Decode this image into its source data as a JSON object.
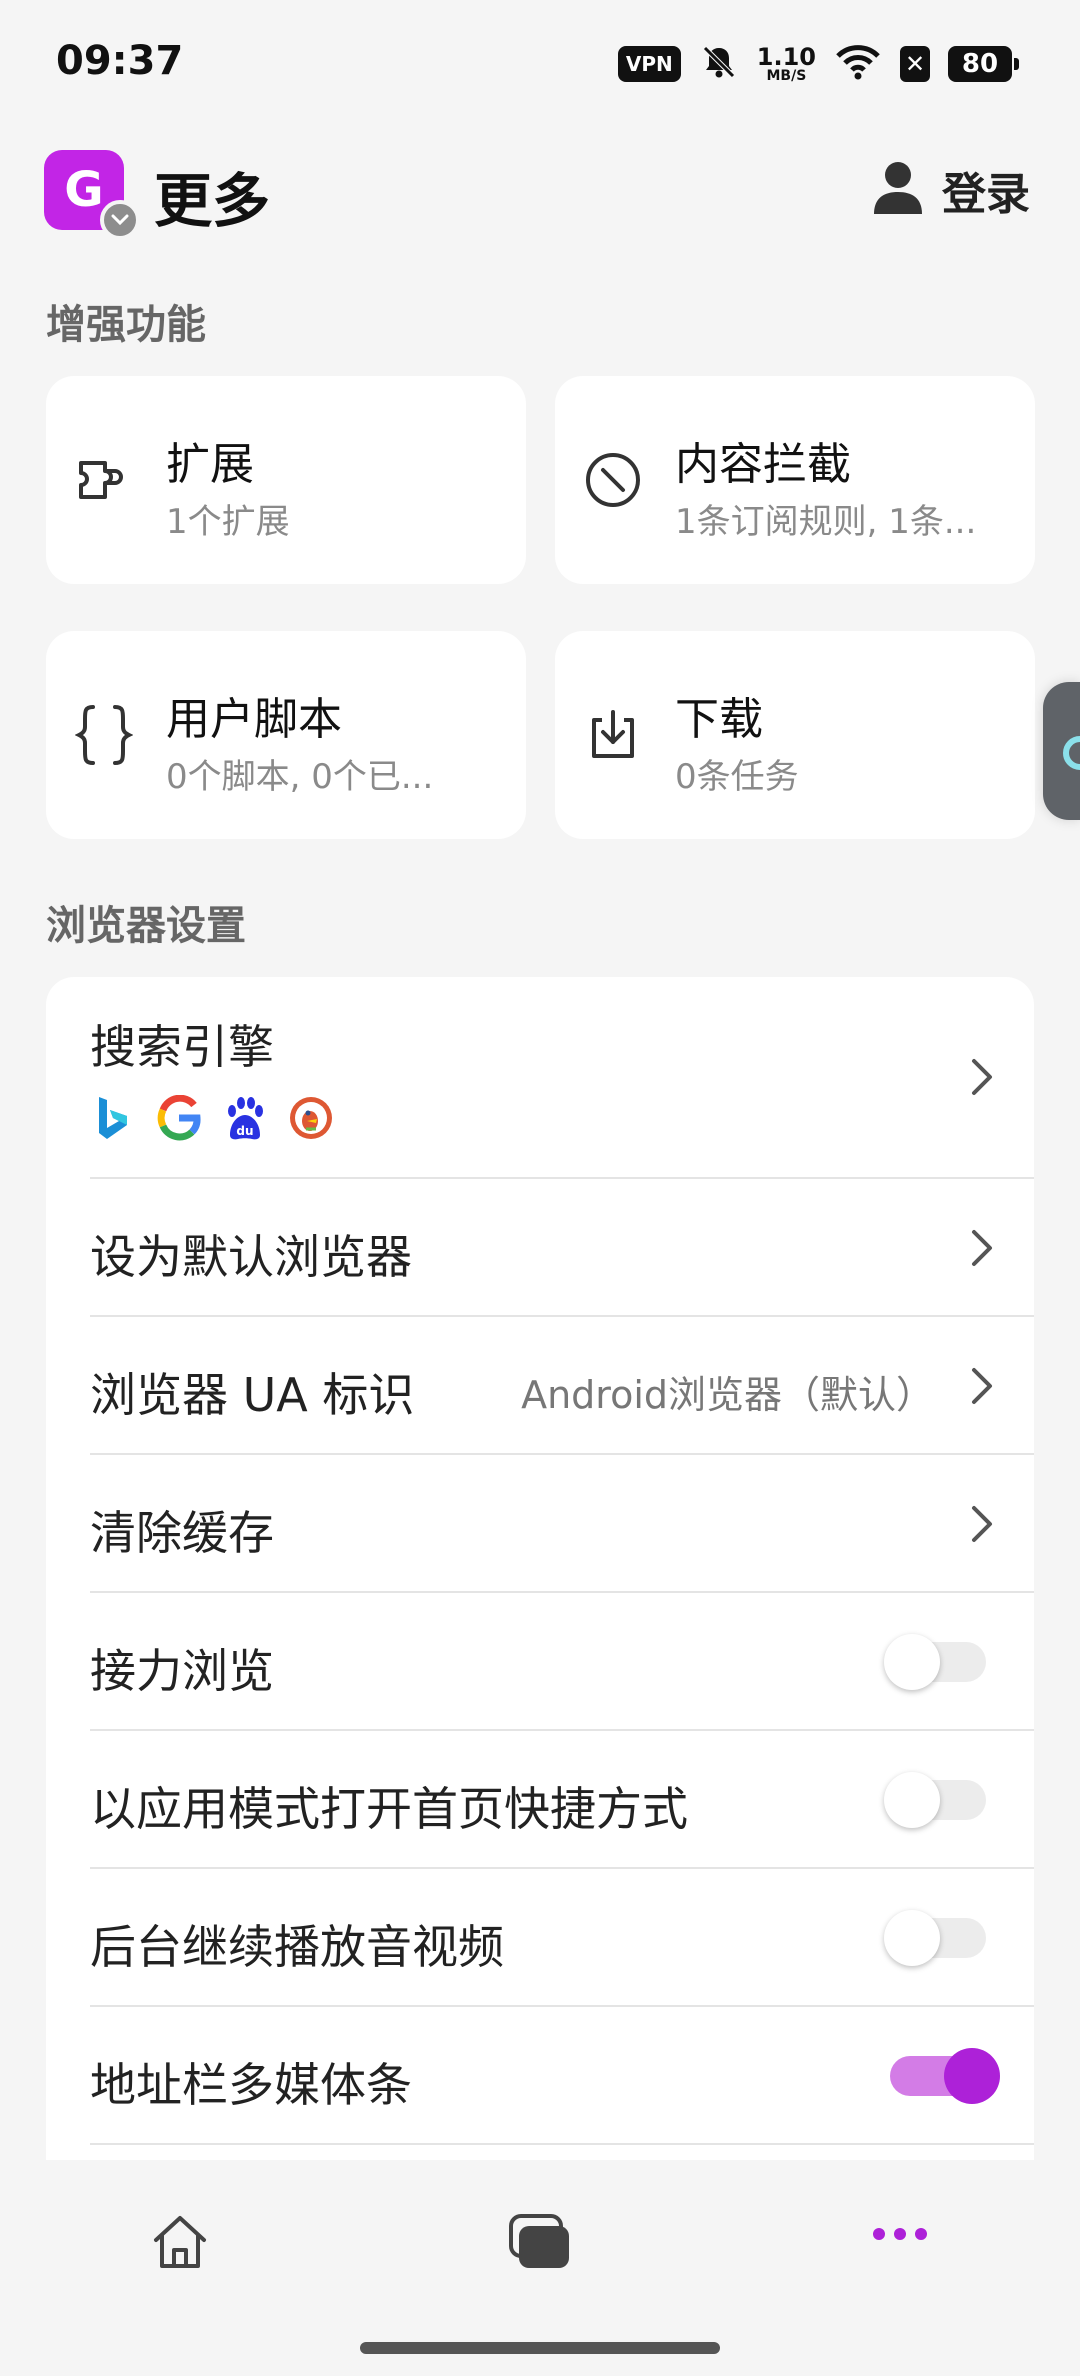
{
  "status_bar": {
    "time": "09:37",
    "vpn": "VPN",
    "speed_value": "1.10",
    "speed_unit": "MB/S",
    "battery": "80",
    "icons": [
      "vpn-icon",
      "mute-bell-icon",
      "wifi-icon",
      "sim-blocked-icon",
      "battery-icon"
    ]
  },
  "header": {
    "avatar_letter": "G",
    "title": "更多",
    "login_label": "登录"
  },
  "enhance": {
    "section_title": "增强功能",
    "cards": [
      {
        "title": "扩展",
        "subtitle": "1个扩展",
        "icon": "puzzle-icon"
      },
      {
        "title": "内容拦截",
        "subtitle": "1条订阅规则, 1条...",
        "icon": "block-icon"
      },
      {
        "title": "用户脚本",
        "subtitle": "0个脚本, 0个已...",
        "icon": "braces-icon"
      },
      {
        "title": "下载",
        "subtitle": "0条任务",
        "icon": "download-icon"
      }
    ]
  },
  "browser_settings": {
    "section_title": "浏览器设置",
    "search_engine": {
      "label": "搜索引擎",
      "engines": [
        "bing-icon",
        "google-icon",
        "baidu-icon",
        "duckduckgo-icon"
      ]
    },
    "default_browser": {
      "label": "设为默认浏览器"
    },
    "ua": {
      "label": "浏览器 UA 标识",
      "value": "Android浏览器（默认）"
    },
    "clear_cache": {
      "label": "清除缓存"
    },
    "relay_browsing": {
      "label": "接力浏览",
      "enabled": false
    },
    "app_mode_shortcut": {
      "label": "以应用模式打开首页快捷方式",
      "enabled": false
    },
    "background_media": {
      "label": "后台继续播放音视频",
      "enabled": false
    },
    "address_bar_media": {
      "label": "地址栏多媒体条",
      "enabled": true
    }
  },
  "bottom_nav": {
    "items": [
      "home-icon",
      "tabs-icon",
      "more-icon"
    ],
    "active": "more-icon"
  },
  "colors": {
    "accent": "#ad21d8",
    "avatar": "#c225e6",
    "background": "#f5f5f5"
  }
}
